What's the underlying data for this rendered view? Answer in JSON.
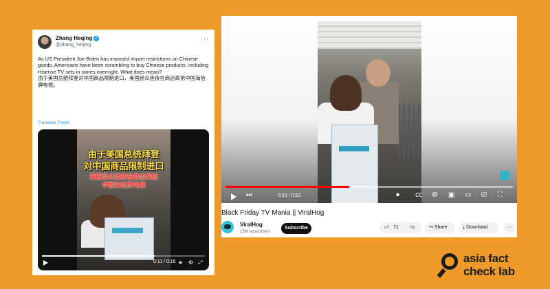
{
  "tweet": {
    "author_name": "Zhang Heqing",
    "author_handle": "@zhang_heqing",
    "text_en": "As US President Joe Biden has imposed import restrictions on Chinese goods, Americans have been scrambling to buy Chinese products, including Hisense TV sets in stores overnight. What does mean?",
    "text_zh": "由于美国总统拜登对中国商品限制进口，美国民众连夜在商店疯抢中国海信牌电视。",
    "translate_label": "Translate Tweet",
    "video": {
      "caption_line1": "由于美国总统拜登",
      "caption_line2": "对中国商品限制进口",
      "caption_line3": "美国民众连夜在商店疯抢",
      "caption_line4": "中国海信牌电视",
      "time": "0:11 / 0:16",
      "progress": 0.69
    }
  },
  "youtube": {
    "title": "Black Friday TV Mania || ViralHog",
    "channel_name": "ViralHog",
    "subscribers": "15M subscribers",
    "subscribe_label": "Subscribe",
    "likes": "71",
    "share_label": "Share",
    "download_label": "Download",
    "time": "0:23 / 0:53",
    "progress": 0.43
  },
  "logo": {
    "line1": "asia fact",
    "line2": "check lab"
  },
  "colors": {
    "background": "#ee9a2b",
    "caption_yellow": "#ffe14a",
    "caption_red": "#ff3b30",
    "yt_red": "#ff0000",
    "verified_blue": "#1d9bf0"
  },
  "icons": [
    "verified-badge-icon",
    "more-icon",
    "play-icon",
    "volume-icon",
    "settings-icon",
    "fullscreen-icon",
    "next-icon",
    "cc-icon",
    "miniplayer-icon",
    "theater-icon",
    "cast-icon",
    "thumbs-up-icon",
    "thumbs-down-icon",
    "share-icon",
    "download-icon",
    "search-magnifier-logo-icon"
  ]
}
